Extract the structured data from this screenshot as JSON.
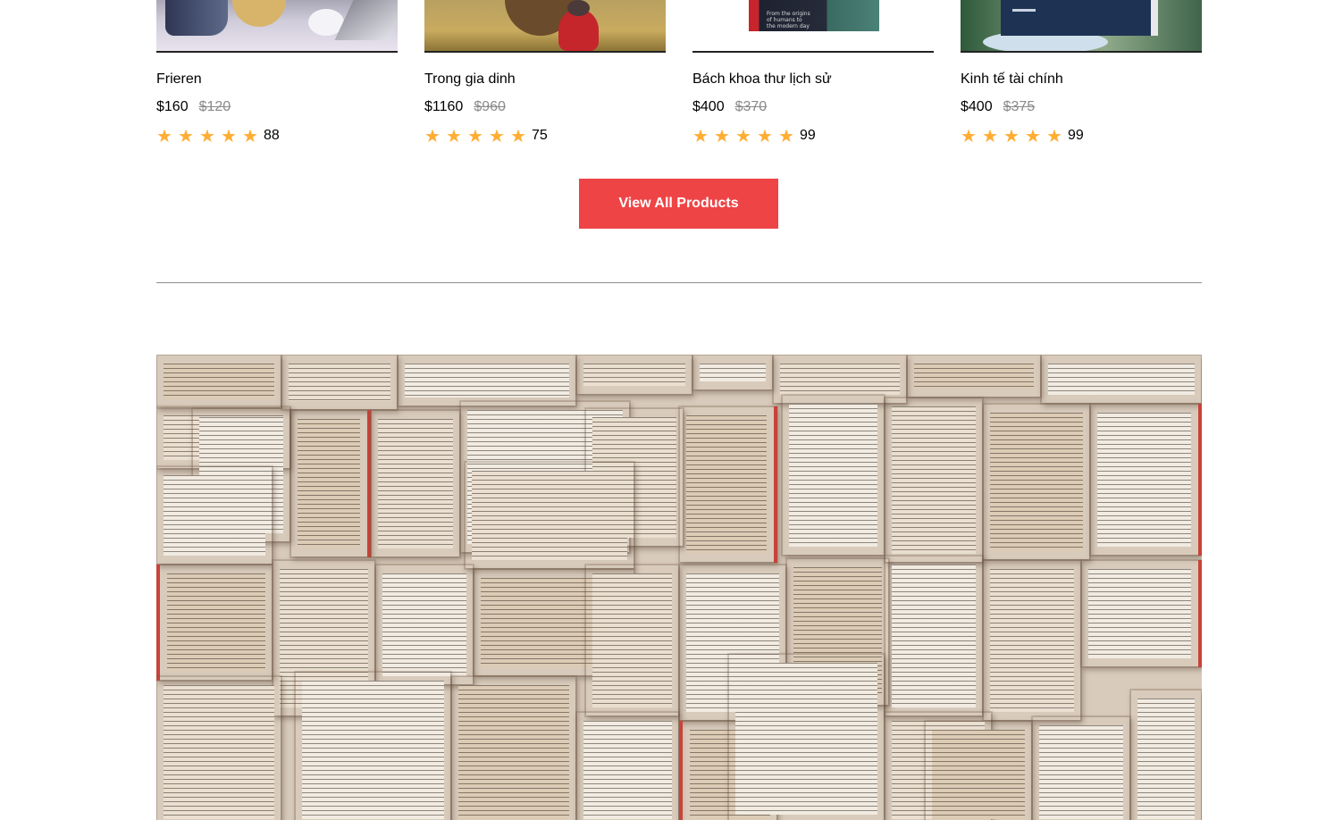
{
  "products": [
    {
      "title": "Frieren",
      "price": "$160",
      "old_price": "$120",
      "rating": 5,
      "reviews": "88"
    },
    {
      "title": "Trong gia dinh",
      "price": "$1160",
      "old_price": "$960",
      "rating": 5,
      "reviews": "75"
    },
    {
      "title": "Bách khoa thư lịch sử",
      "price": "$400",
      "old_price": "$370",
      "rating": 5,
      "reviews": "99",
      "cover_text": "From the origins of humans to the modern day"
    },
    {
      "title": "Kinh tế tài chính",
      "price": "$400",
      "old_price": "$375",
      "rating": 5,
      "reviews": "99"
    }
  ],
  "star_glyph": "★",
  "view_all_label": "View All Products",
  "colors": {
    "accent": "#ee4446",
    "star": "#ffad33",
    "old_price": "#8a8a8a",
    "divider": "#8c8c8c"
  },
  "banner": {
    "image": "open-books-photo"
  }
}
